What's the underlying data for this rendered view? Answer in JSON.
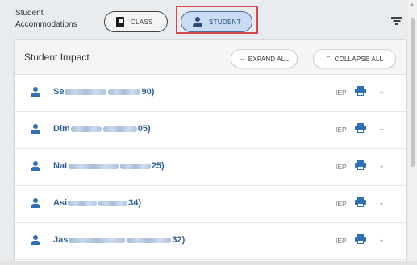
{
  "header": {
    "title_line1": "Student",
    "title_line2": "Accommodations",
    "toggle_class_label": "CLASS",
    "toggle_student_label": "STUDENT"
  },
  "panel": {
    "title": "Student Impact",
    "expand_all_label": "EXPAND ALL",
    "collapse_all_label": "COLLAPSE ALL"
  },
  "students": [
    {
      "name_start": "Se",
      "name_end": "90)",
      "badge": "IEP"
    },
    {
      "name_start": "Dim",
      "name_end": "05)",
      "badge": "IEP"
    },
    {
      "name_start": "Nat",
      "name_end": "25)",
      "badge": "IEP"
    },
    {
      "name_start": "Asi",
      "name_end": "34)",
      "badge": "IEP"
    },
    {
      "name_start": "Jas",
      "name_end": "32)",
      "badge": "IEP"
    }
  ],
  "colors": {
    "accent": "#2f6fb6",
    "highlight": "#d6484a",
    "active_toggle_bg": "#c9dcf3"
  },
  "icons": [
    "book-icon",
    "person-icon",
    "filter-icon",
    "printer-icon",
    "chevron-down-icon",
    "chevron-up-icon"
  ]
}
